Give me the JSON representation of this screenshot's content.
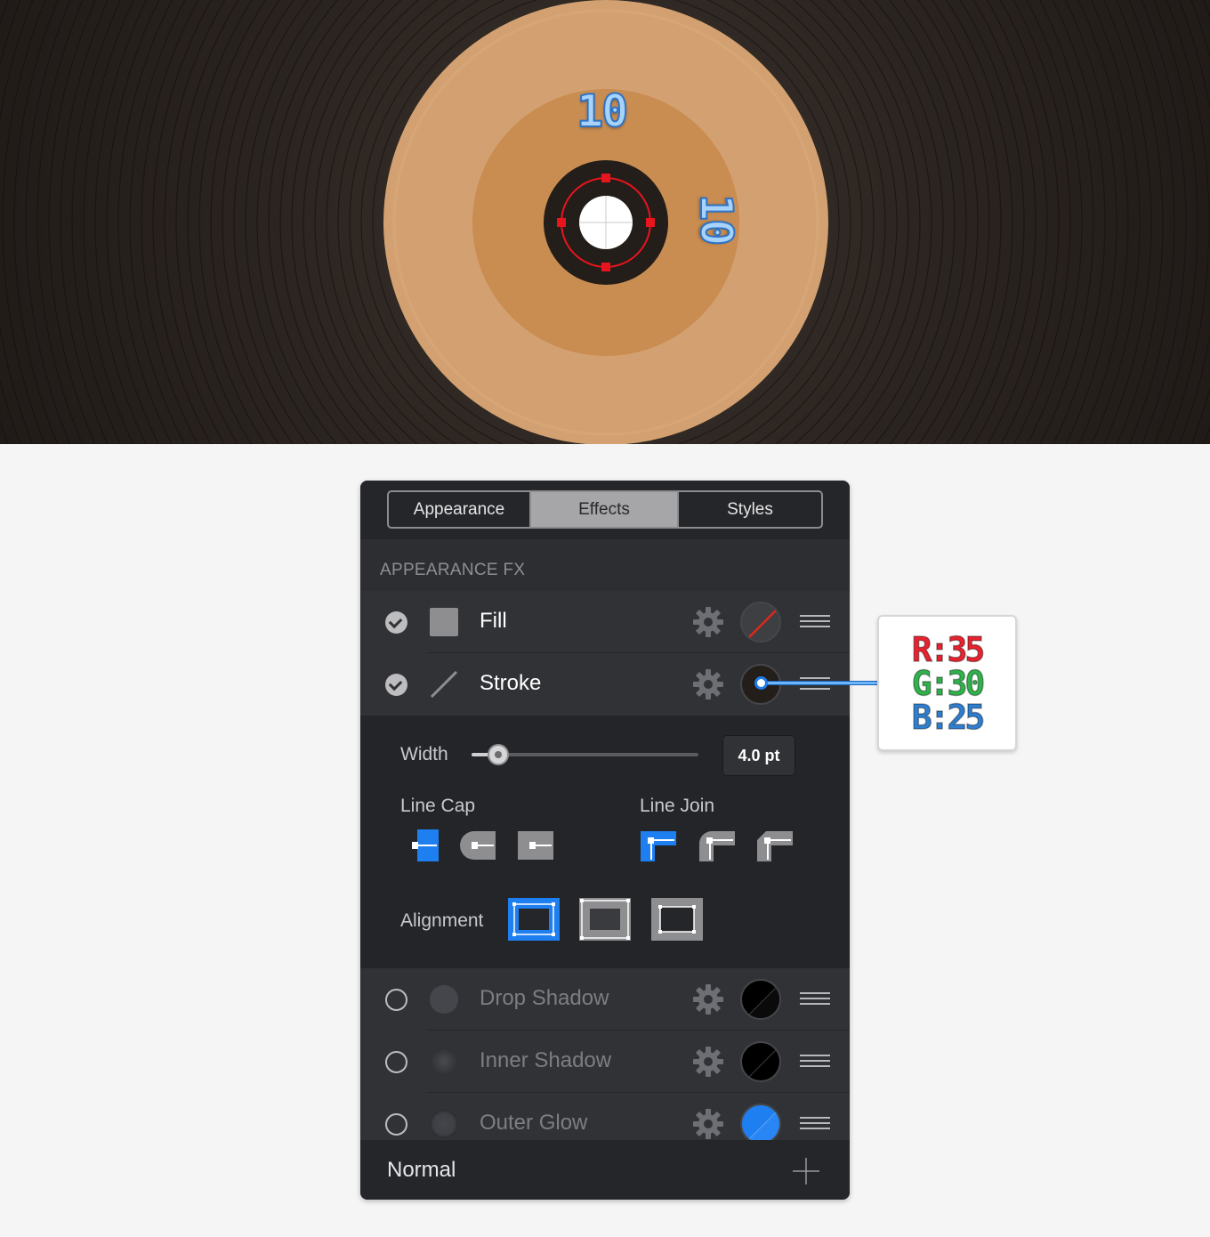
{
  "canvas": {
    "dimension_top": "10",
    "dimension_right": "10"
  },
  "panel": {
    "tabs": [
      {
        "label": "Appearance",
        "active": false
      },
      {
        "label": "Effects",
        "active": true
      },
      {
        "label": "Styles",
        "active": false
      }
    ],
    "section_title": "APPEARANCE FX",
    "fx_rows": [
      {
        "label": "Fill",
        "enabled": true,
        "icon": "fill-square-icon",
        "swatch": "none"
      },
      {
        "label": "Stroke",
        "enabled": true,
        "icon": "stroke-line-icon",
        "swatch": "#231e19"
      },
      {
        "label": "Drop Shadow",
        "enabled": false,
        "icon": "shadow-dot-icon",
        "swatch": "#000000"
      },
      {
        "label": "Inner Shadow",
        "enabled": false,
        "icon": "shadow-dot-icon",
        "swatch": "#000000"
      },
      {
        "label": "Outer Glow",
        "enabled": false,
        "icon": "glow-dot-icon",
        "swatch": "#1e7ff0"
      }
    ],
    "stroke_options": {
      "width_label": "Width",
      "width_value": "4.0 pt",
      "line_cap_label": "Line Cap",
      "line_join_label": "Line Join",
      "alignment_label": "Alignment",
      "selected_cap": "butt",
      "selected_join": "miter",
      "selected_alignment": "inside"
    },
    "footer": {
      "blend_mode": "Normal",
      "add_icon": "plus-icon"
    }
  },
  "color_callout": {
    "r": "R:35",
    "g": "G:30",
    "b": "B:25",
    "colors": {
      "r": "#e8232f",
      "g": "#2fb34a",
      "b": "#2f7fd0"
    }
  },
  "accent": "#1e7ff0"
}
